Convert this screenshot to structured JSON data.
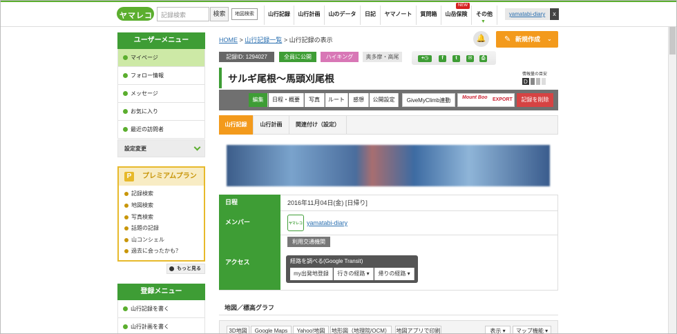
{
  "header": {
    "logo_text": "ヤマレコ",
    "search_placeholder": "記録検索",
    "search_button": "検索",
    "map_search": "地図検索",
    "nav": [
      "山行記録",
      "山行計画",
      "山のデータ",
      "日記",
      "ヤマノート",
      "質問箱",
      "山岳保険",
      "その他"
    ],
    "new_badge": "NEW",
    "username": "yamatabi-diary",
    "close": "x"
  },
  "sidebar": {
    "user_menu_title": "ユーザーメニュー",
    "user_items": [
      "マイページ",
      "フォロー情報",
      "メッセージ",
      "お気に入り",
      "最近の訪問者"
    ],
    "settings": "設定変更",
    "premium_title": "プレミアムプラン",
    "premium_icon": "P",
    "premium_items": [
      "記録検索",
      "地図検索",
      "写真検索",
      "話題の記録",
      "山コンシェル",
      "過去に会ったかも？"
    ],
    "more": "もっと見る",
    "register_title": "登録メニュー",
    "register_items": [
      "山行記録を書く",
      "山行計画を書く"
    ]
  },
  "main": {
    "breadcrumb": {
      "home": "HOME",
      "sep1": ">",
      "list": "山行記録一覧",
      "sep2": ">",
      "current": "山行記録の表示"
    },
    "new_post": "新規作成",
    "record_id": "記録ID: 1294027",
    "visibility": "全員に公開",
    "category": "ハイキング",
    "area": "奥多摩・高尾",
    "title": "サルギ尾根～馬頭刈尾根",
    "info_level_label": "情報量の目安",
    "info_level": "D",
    "edit_buttons": [
      "編集",
      "日程・概要",
      "写真",
      "ルート",
      "感想",
      "公開設定",
      "GiveMyClimb連動"
    ],
    "mountbook_label": "Mount Boo",
    "mountbook_export": "EXPORT",
    "delete": "記録を削除",
    "tabs": [
      "山行記録",
      "山行計画",
      "関連付け（設定）"
    ],
    "rows": {
      "date_label": "日程",
      "date_value": "2016年11月04日(金) [日帰り]",
      "member_label": "メンバー",
      "member_name": "yamatabi-diary",
      "access_label": "アクセス",
      "transit_tag": "利用交通機関",
      "transit_title": "経路を調べる(Google Transit)",
      "transit_buttons": [
        "my出発地登録",
        "行きの経路",
        "帰りの経路"
      ]
    },
    "map_title": "地図／標高グラフ",
    "map_tabs": [
      "3D地図",
      "Google Maps",
      "Yahoo!地図",
      "地形図（地理院/OCM）",
      "地図アプリで印刷"
    ],
    "map_right": [
      "表示",
      "マップ機能"
    ]
  },
  "colors": {
    "green": "#3e9d35",
    "orange": "#f39a1c",
    "red": "#d64343",
    "gold": "#e7b92a"
  }
}
